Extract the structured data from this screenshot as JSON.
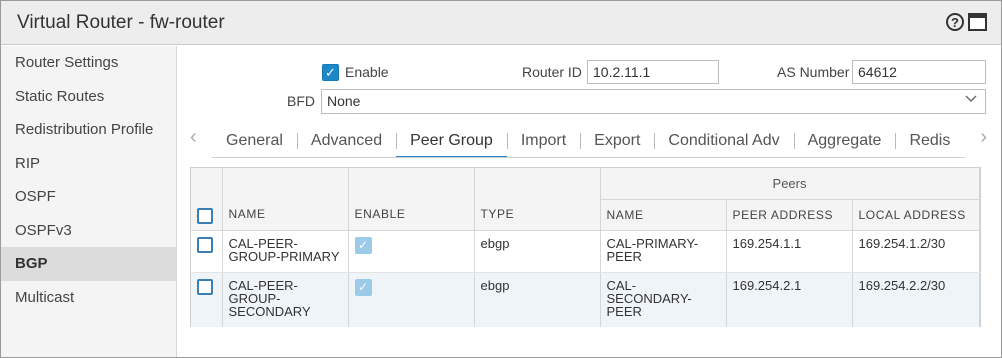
{
  "window": {
    "title": "Virtual Router - fw-router"
  },
  "sidebar": {
    "items": [
      {
        "label": "Router Settings"
      },
      {
        "label": "Static Routes"
      },
      {
        "label": "Redistribution Profile"
      },
      {
        "label": "RIP"
      },
      {
        "label": "OSPF"
      },
      {
        "label": "OSPFv3"
      },
      {
        "label": "BGP",
        "active": true
      },
      {
        "label": "Multicast"
      }
    ]
  },
  "form": {
    "enable_label": "Enable",
    "enable_checked": true,
    "router_id_label": "Router ID",
    "router_id_value": "10.2.11.1",
    "as_number_label": "AS Number",
    "as_number_value": "64612",
    "bfd_label": "BFD",
    "bfd_value": "None"
  },
  "tabs": [
    {
      "label": "General"
    },
    {
      "label": "Advanced"
    },
    {
      "label": "Peer Group",
      "active": true
    },
    {
      "label": "Import"
    },
    {
      "label": "Export"
    },
    {
      "label": "Conditional Adv"
    },
    {
      "label": "Aggregate"
    },
    {
      "label": "Redis"
    }
  ],
  "table": {
    "group_header": "Peers",
    "columns": {
      "name": "NAME",
      "enable": "ENABLE",
      "type": "TYPE",
      "peer_name": "NAME",
      "peer_address": "PEER ADDRESS",
      "local_address": "LOCAL ADDRESS"
    },
    "rows": [
      {
        "name": "CAL-PEER-GROUP-PRIMARY",
        "enabled": true,
        "type": "ebgp",
        "peer_name": "CAL-PRIMARY-PEER",
        "peer_address": "169.254.1.1",
        "local_address": "169.254.1.2/30"
      },
      {
        "name": "CAL-PEER-GROUP-SECONDARY",
        "enabled": true,
        "type": "ebgp",
        "peer_name": "CAL-SECONDARY-PEER",
        "peer_address": "169.254.2.1",
        "local_address": "169.254.2.2/30"
      }
    ]
  },
  "colors": {
    "accent": "#1e88c7",
    "selected_row": "#eef4f8",
    "sidebar_active": "#dcdcdc"
  }
}
